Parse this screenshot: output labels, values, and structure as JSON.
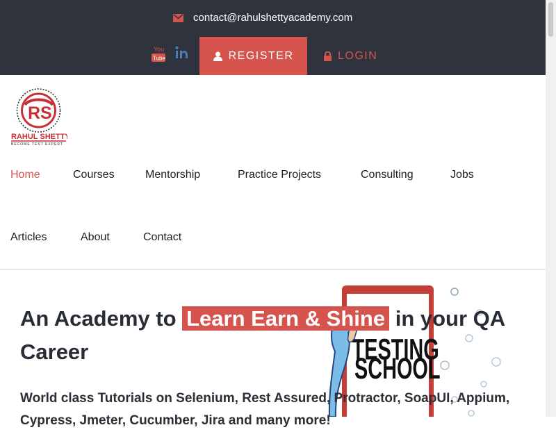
{
  "topbar": {
    "email": "contact@rahulshettyacademy.com",
    "social": [
      "youtube-icon",
      "linkedin-icon"
    ],
    "register_label": "REGISTER",
    "login_label": "LOGIN"
  },
  "brand": {
    "logo_initials": "RS",
    "logo_name": "RAHUL SHETTY",
    "logo_tagline": "BECOME TEST EXPERT"
  },
  "nav": {
    "items": [
      "Home",
      "Courses",
      "Mentorship",
      "Practice Projects",
      "Consulting",
      "Jobs",
      "Articles",
      "About",
      "Contact"
    ],
    "active": "Home"
  },
  "hero": {
    "title_prefix": "An Academy to ",
    "title_highlight": "Learn Earn & Shine",
    "title_suffix": " in your QA Career",
    "subtitle": "World class Tutorials on Selenium, Rest Assured, Protractor, SoapUI, Appium, Cypress, Jmeter, Cucumber, Jira and many more!",
    "image_text_top": "TESTING",
    "image_text_bottom": "SCHOOL"
  },
  "colors": {
    "accent": "#d6544e",
    "topbar": "#2e333d"
  }
}
